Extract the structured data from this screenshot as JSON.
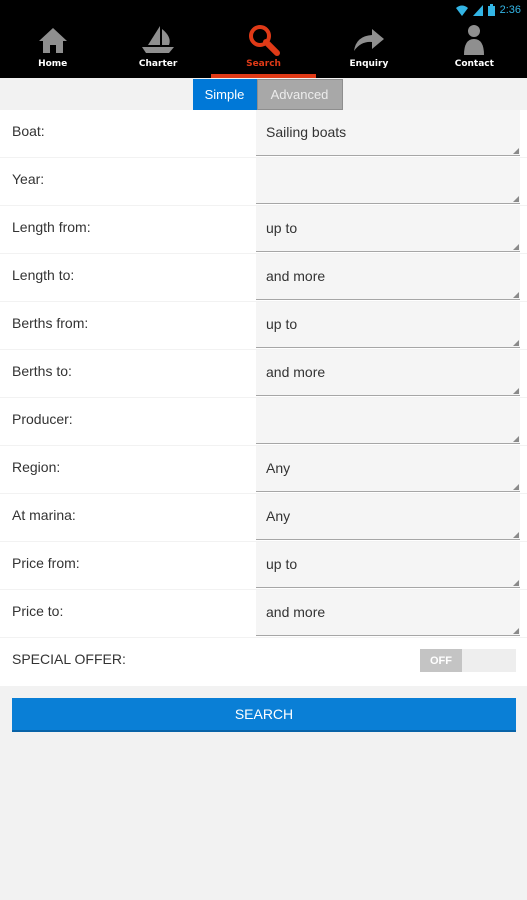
{
  "status_bar": {
    "time": "2:36"
  },
  "nav": [
    {
      "label": "Home",
      "icon": "home-icon"
    },
    {
      "label": "Charter",
      "icon": "sailboat-icon"
    },
    {
      "label": "Search",
      "icon": "search-icon",
      "active": true
    },
    {
      "label": "Enquiry",
      "icon": "share-arrow-icon"
    },
    {
      "label": "Contact",
      "icon": "person-icon"
    }
  ],
  "tabs": {
    "simple": "Simple",
    "advanced": "Advanced",
    "selected": "Simple"
  },
  "form": {
    "rows": [
      {
        "label": "Boat:",
        "value": "Sailing boats"
      },
      {
        "label": "Year:",
        "value": ""
      },
      {
        "label": "Length from:",
        "value": "up to"
      },
      {
        "label": "Length to:",
        "value": "and more"
      },
      {
        "label": "Berths from:",
        "value": "up to"
      },
      {
        "label": "Berths to:",
        "value": "and more"
      },
      {
        "label": "Producer:",
        "value": ""
      },
      {
        "label": "Region:",
        "value": "Any"
      },
      {
        "label": "At marina:",
        "value": "Any"
      },
      {
        "label": "Price from:",
        "value": "up to"
      },
      {
        "label": "Price to:",
        "value": "and more"
      }
    ],
    "special_offer": {
      "label": "SPECIAL OFFER:",
      "toggle_state": "OFF"
    }
  },
  "search_button": "SEARCH",
  "colors": {
    "accent": "#0078d7",
    "active_nav": "#e03a17",
    "status_icons": "#33b5e5"
  }
}
